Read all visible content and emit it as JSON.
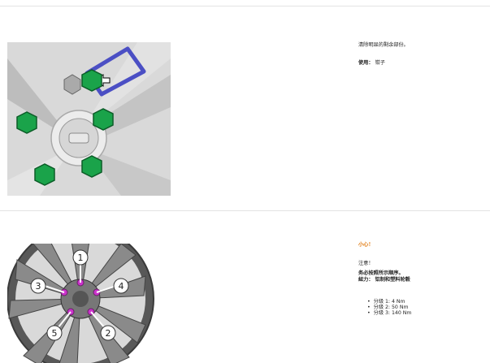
{
  "section1": {
    "instruction": "清除明显的剩余部份。",
    "use_label": "使用：",
    "use_value": "钳子"
  },
  "section2": {
    "warning": "小心！",
    "note_title": "注意！",
    "note_text": "务必按照所示顺序。",
    "torque_label": "紐力：",
    "torque_value": "铝制和塑料轮毂",
    "steps": [
      "分级 1: 4 Nm",
      "分级 2: 50 Nm",
      "分级 3: 140 Nm"
    ],
    "bolt_numbers": [
      "1",
      "2",
      "3",
      "4",
      "5"
    ]
  },
  "colors": {
    "nut_green": "#1aa34a",
    "tool_blue": "#4b4fc4",
    "bolt_purple": "#cc33cc",
    "warning_orange": "#e07a10"
  }
}
